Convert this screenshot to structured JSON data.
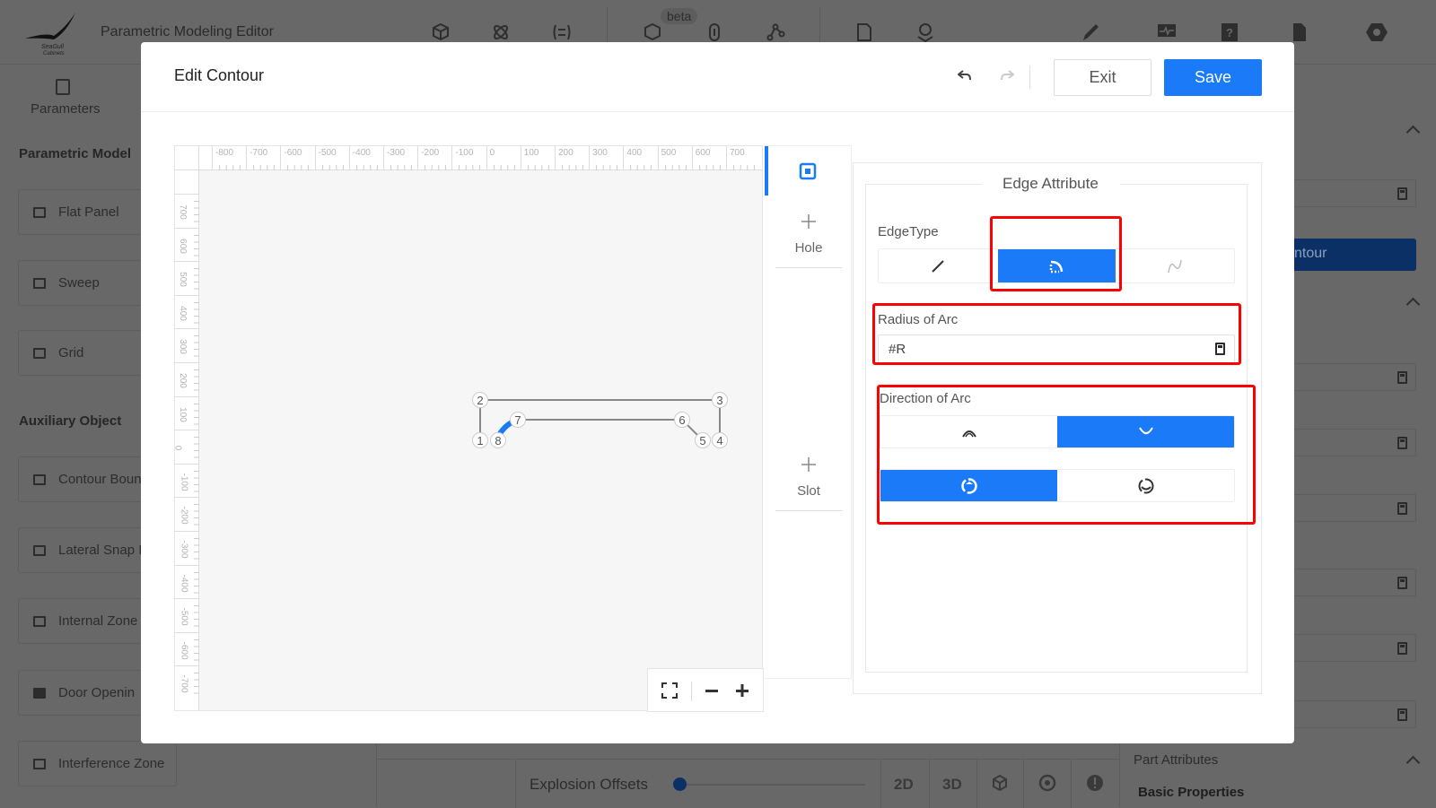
{
  "app": {
    "title": "Parametric Modeling Editor",
    "logo_text": "SeaGull Cabinets",
    "beta_badge": "beta"
  },
  "sidebar": {
    "tab_label": "Parameters",
    "sections": [
      {
        "title": "Parametric Model",
        "items": [
          "Flat Panel",
          "Sweep",
          "Grid"
        ]
      },
      {
        "title": "Auxiliary Object",
        "items": [
          "Contour Boun",
          "Lateral Snap I",
          "Internal Zone",
          "Door Openin",
          "Interference Zone"
        ]
      }
    ]
  },
  "right_panel": {
    "action_button": "ntour",
    "part_attributes": "Part Attributes",
    "basic_properties": "Basic Properties"
  },
  "bottom_toolbar": {
    "explosion_label": "Explosion Offsets",
    "explosion_value": 0,
    "buttons": [
      "2D",
      "3D"
    ]
  },
  "modal": {
    "title": "Edit Contour",
    "exit_label": "Exit",
    "save_label": "Save",
    "ruler": {
      "top": [
        "-800",
        "-700",
        "-600",
        "-500",
        "-400",
        "-300",
        "-200",
        "-100",
        "0",
        "100",
        "200",
        "300",
        "400",
        "500",
        "600",
        "700"
      ],
      "left": [
        "700",
        "600",
        "500",
        "400",
        "300",
        "200",
        "100",
        "0",
        "-100",
        "-200",
        "-300",
        "-400",
        "-500",
        "-600",
        "-700"
      ]
    },
    "nodes": [
      "1",
      "2",
      "3",
      "4",
      "5",
      "6",
      "7",
      "8"
    ],
    "tools": [
      {
        "label": "Hole"
      },
      {
        "label": "Slot"
      }
    ],
    "edge_attribute": {
      "title": "Edge Attribute",
      "edge_type_label": "EdgeType",
      "edge_types": [
        "line",
        "arc",
        "curve"
      ],
      "selected_edge_type": "arc",
      "radius_label": "Radius of Arc",
      "radius_value": "#R",
      "direction_label": "Direction of Arc",
      "direction_selected": [
        "concave",
        "clockwise"
      ]
    },
    "accent_color": "#1a7af8",
    "highlight_color": "#ff0000"
  }
}
